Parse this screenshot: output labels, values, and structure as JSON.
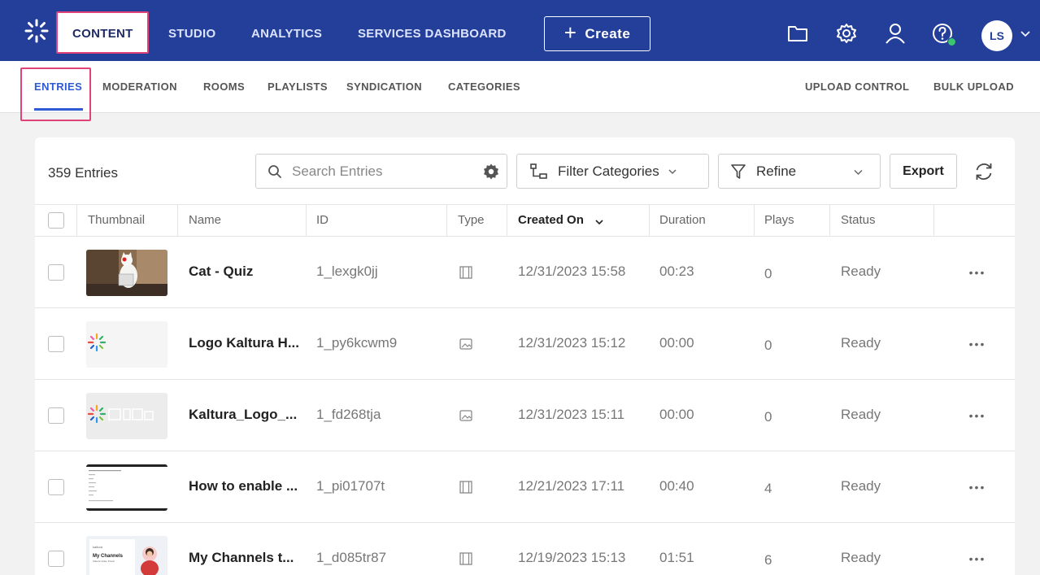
{
  "topnav": {
    "items": [
      "CONTENT",
      "STUDIO",
      "ANALYTICS",
      "SERVICES DASHBOARD"
    ],
    "create_label": "Create",
    "user_initials": "LS"
  },
  "subnav": {
    "items": [
      "ENTRIES",
      "MODERATION",
      "ROOMS",
      "PLAYLISTS",
      "SYNDICATION",
      "CATEGORIES"
    ],
    "right_items": [
      "UPLOAD CONTROL",
      "BULK UPLOAD"
    ]
  },
  "toolbar": {
    "entries_count": "359 Entries",
    "search_placeholder": "Search Entries",
    "filter_categories": "Filter Categories",
    "refine": "Refine",
    "export": "Export"
  },
  "table": {
    "headers": [
      "Thumbnail",
      "Name",
      "ID",
      "Type",
      "Created On",
      "Duration",
      "Plays",
      "Status"
    ],
    "rows": [
      {
        "name": "Cat - Quiz",
        "id": "1_lexgk0jj",
        "type": "video-icon",
        "created": "12/31/2023 15:58",
        "duration": "00:23",
        "plays": "0",
        "status": "Ready",
        "more": "•••"
      },
      {
        "name": "Logo Kaltura H...",
        "id": "1_py6kcwm9",
        "type": "image-icon",
        "created": "12/31/2023 15:12",
        "duration": "00:00",
        "plays": "0",
        "status": "Ready",
        "more": "•••"
      },
      {
        "name": "Kaltura_Logo_...",
        "id": "1_fd268tja",
        "type": "image-icon",
        "created": "12/31/2023 15:11",
        "duration": "00:00",
        "plays": "0",
        "status": "Ready",
        "more": "•••"
      },
      {
        "name": "How to enable ...",
        "id": "1_pi01707t",
        "type": "video-icon",
        "created": "12/21/2023 17:11",
        "duration": "00:40",
        "plays": "4",
        "status": "Ready",
        "more": "•••"
      },
      {
        "name": "My Channels t...",
        "id": "1_d085tr87",
        "type": "video-icon",
        "created": "12/19/2023 15:13",
        "duration": "01:51",
        "plays": "6",
        "status": "Ready",
        "more": "•••"
      }
    ]
  },
  "thumb_text": {
    "channels_brand": "kaltura",
    "channels_title": "My Channels",
    "channels_sub": "Kaltura Video Portal"
  },
  "colors": {
    "topbar": "#233f9a",
    "accent": "#2e5bd1",
    "highlight": "#e0427a"
  }
}
